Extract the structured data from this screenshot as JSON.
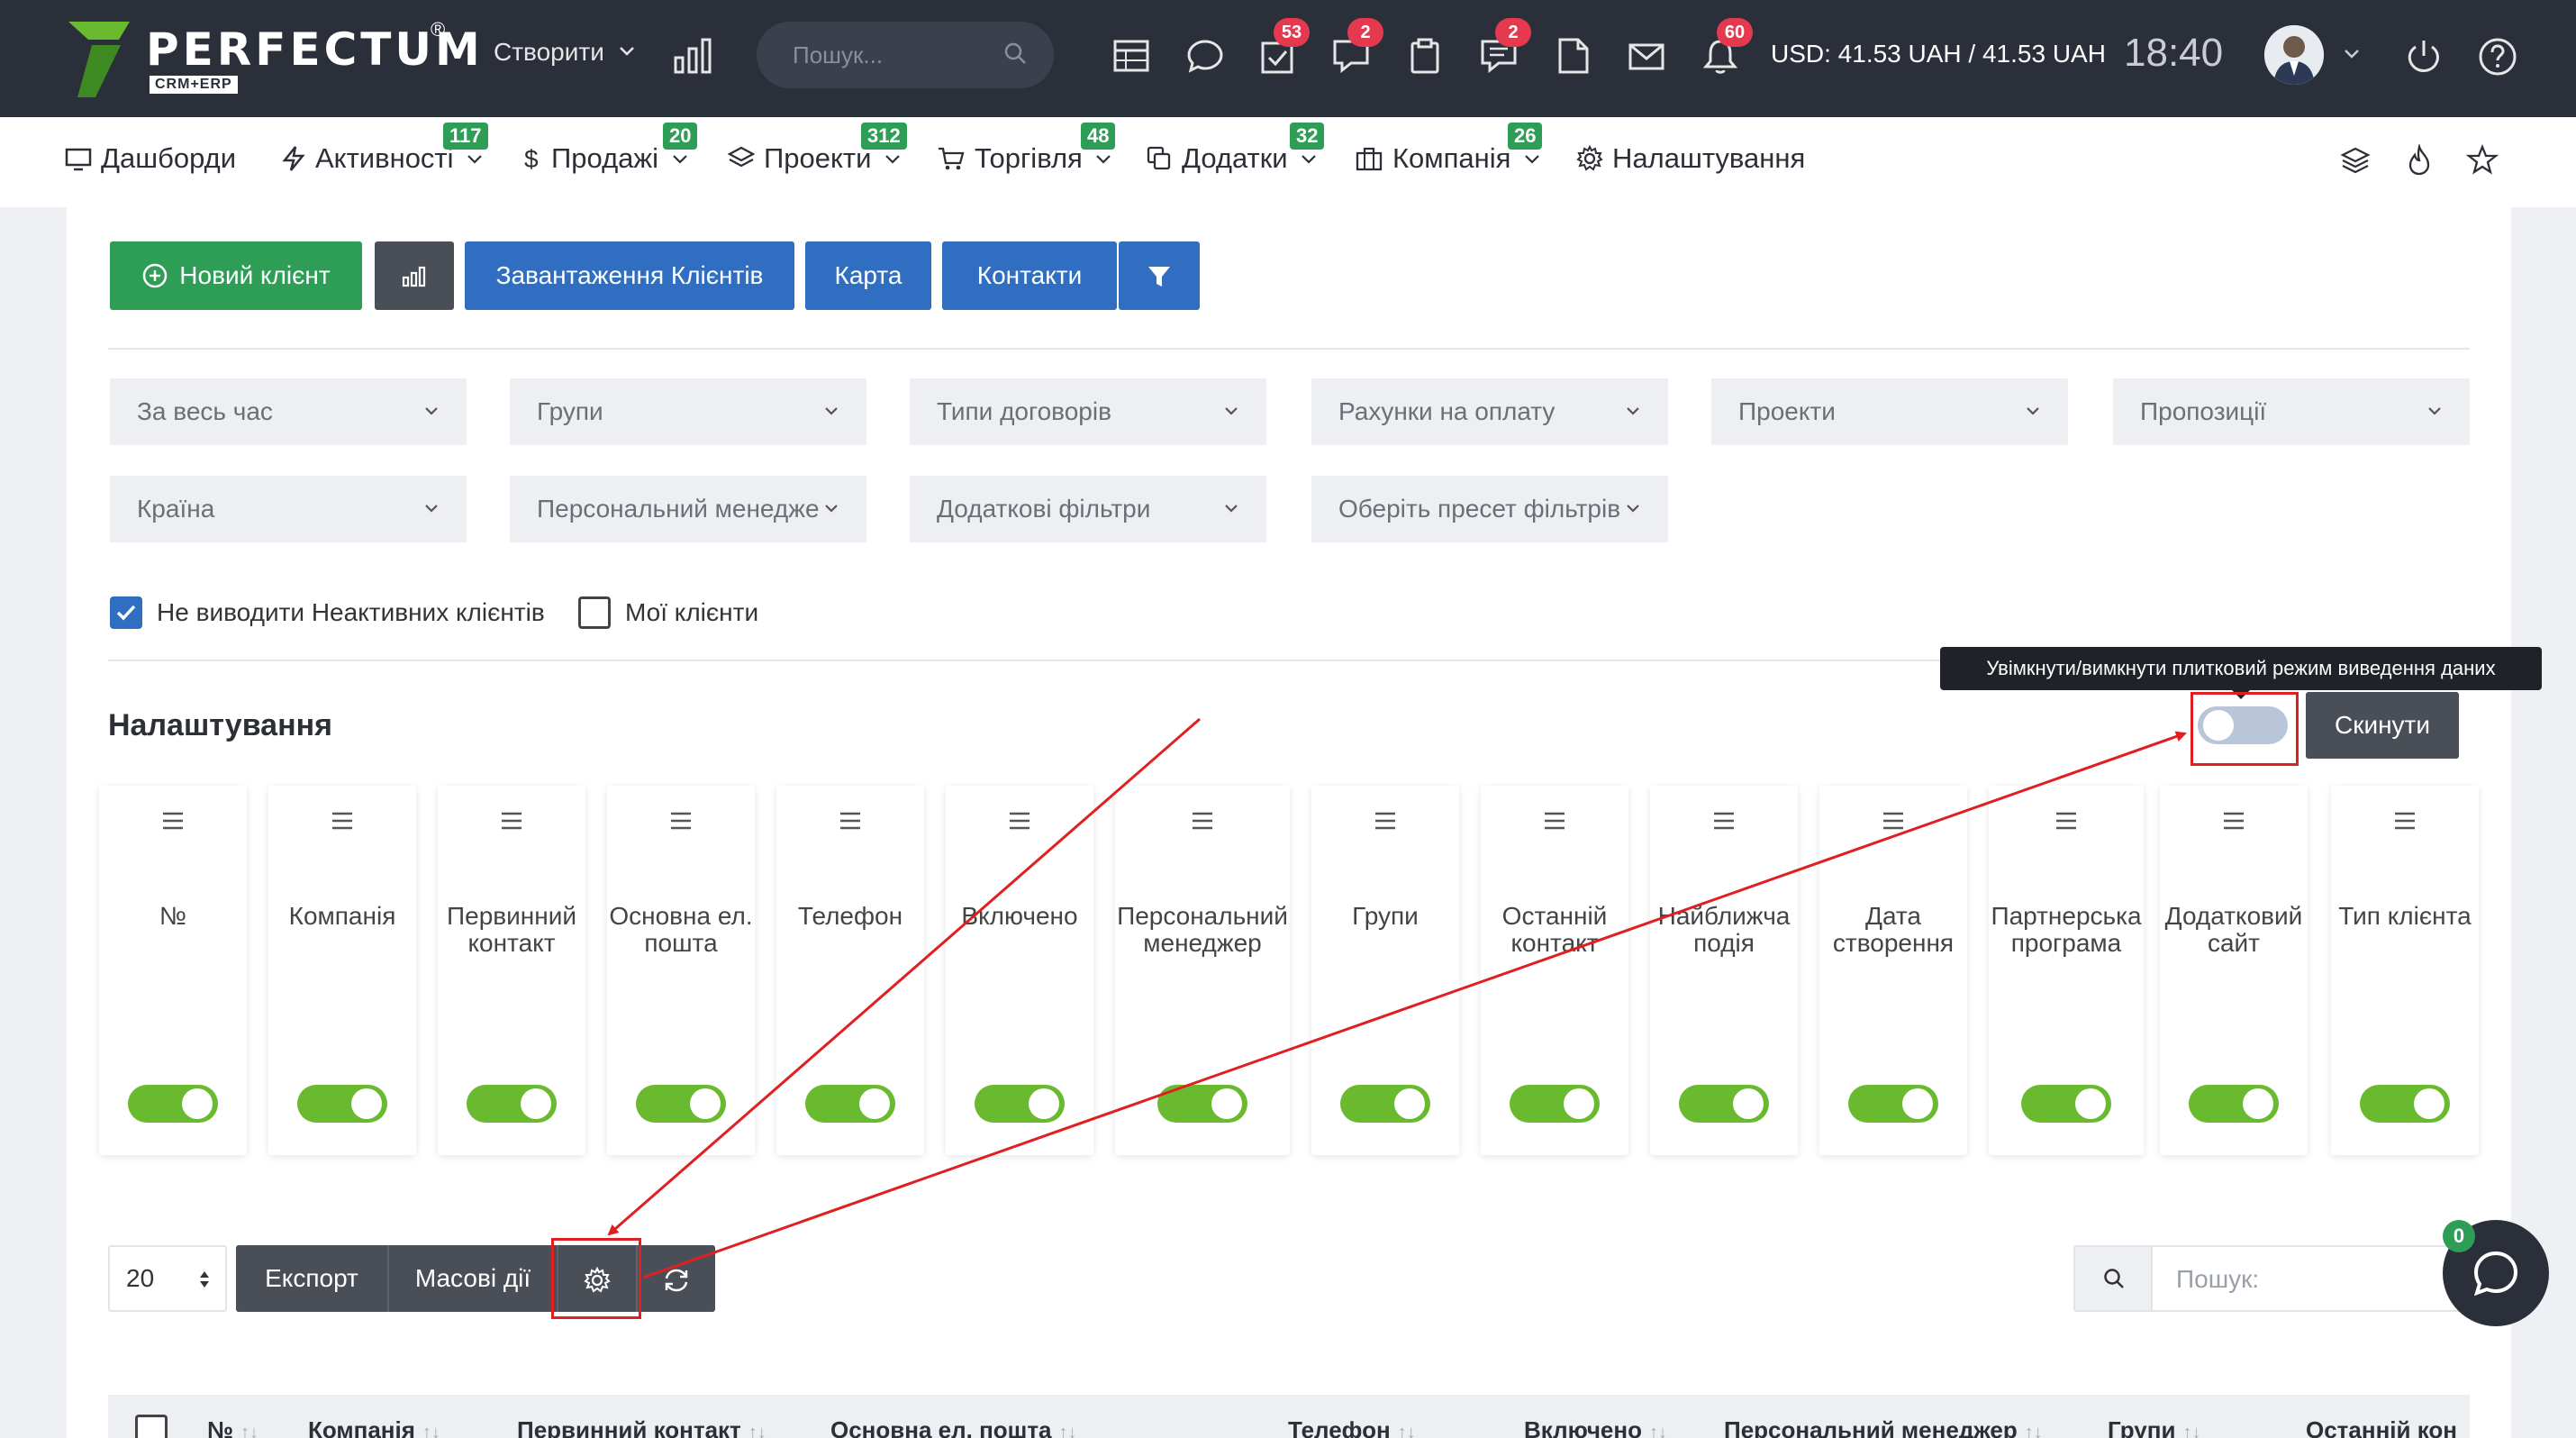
{
  "topbar": {
    "logo_text": "PERFECTUM",
    "logo_reg": "®",
    "logo_sub": "CRM+ERP",
    "create_label": "Створити",
    "search_placeholder": "Пошук...",
    "badges": {
      "tasks": "53",
      "discussions": "2",
      "notes": "2",
      "notifications": "60"
    },
    "currency": "USD: 41.53 UAH / 41.53 UAH",
    "time": "18:40"
  },
  "nav": {
    "items": [
      {
        "label": "Дашборди",
        "badge": ""
      },
      {
        "label": "Активності",
        "badge": "117"
      },
      {
        "label": "Продажі",
        "badge": "20"
      },
      {
        "label": "Проекти",
        "badge": "312"
      },
      {
        "label": "Торгівля",
        "badge": "48"
      },
      {
        "label": "Додатки",
        "badge": "32"
      },
      {
        "label": "Компанія",
        "badge": "26"
      },
      {
        "label": "Налаштування",
        "badge": ""
      }
    ]
  },
  "actions": {
    "new_client": "Новий клієнт",
    "upload_clients": "Завантаження Клієнтів",
    "map": "Карта",
    "contacts": "Контакти"
  },
  "filters": {
    "row1": [
      "За весь час",
      "Групи",
      "Типи договорів",
      "Рахунки на оплату",
      "Проекти",
      "Пропозиції"
    ],
    "row2": [
      "Країна",
      "Персональний менедже",
      "Додаткові фільтри",
      "Оберіть пресет фільтрів"
    ]
  },
  "checkboxes": {
    "hide_inactive": {
      "label": "Не виводити Неактивних клієнтів",
      "checked": true
    },
    "my_clients": {
      "label": "Мої клієнти",
      "checked": false
    }
  },
  "settings": {
    "title": "Налаштування",
    "tooltip": "Увімкнути/вимкнути плитковий режим виведення даних",
    "reset_label": "Скинути",
    "tile_mode_enabled": false,
    "columns": [
      {
        "name": "№",
        "enabled": true
      },
      {
        "name": "Компанія",
        "enabled": true
      },
      {
        "name": "Первинний контакт",
        "enabled": true
      },
      {
        "name": "Основна ел. пошта",
        "enabled": true
      },
      {
        "name": "Телефон",
        "enabled": true
      },
      {
        "name": "Включено",
        "enabled": true
      },
      {
        "name": "Персональний менеджер",
        "enabled": true
      },
      {
        "name": "Групи",
        "enabled": true
      },
      {
        "name": "Останній контакт",
        "enabled": true
      },
      {
        "name": "Найближча подія",
        "enabled": true
      },
      {
        "name": "Дата створення",
        "enabled": true
      },
      {
        "name": "Партнерська програма",
        "enabled": true
      },
      {
        "name": "Додатковий сайт",
        "enabled": true
      },
      {
        "name": "Тип клієнта",
        "enabled": true
      }
    ]
  },
  "table_toolbar": {
    "page_size": "20",
    "export_label": "Експорт",
    "mass_actions_label": "Масові дії",
    "search_placeholder": "Пошук:"
  },
  "chat": {
    "unread": "0"
  },
  "table_headers": [
    "№",
    "Компанія",
    "Первинний контакт",
    "Основна ел. пошта",
    "Телефон",
    "Включено",
    "Персональний менеджер",
    "Групи",
    "Останній кон"
  ],
  "colors": {
    "topbar": "#2b2f3a",
    "green": "#2e9e57",
    "blue": "#2f6ec0",
    "dark_button": "#4a4f57",
    "toggle_on": "#6aba2f",
    "toggle_off": "#b9c6da",
    "badge_red": "#e53950",
    "annotation_red": "#e02020"
  }
}
